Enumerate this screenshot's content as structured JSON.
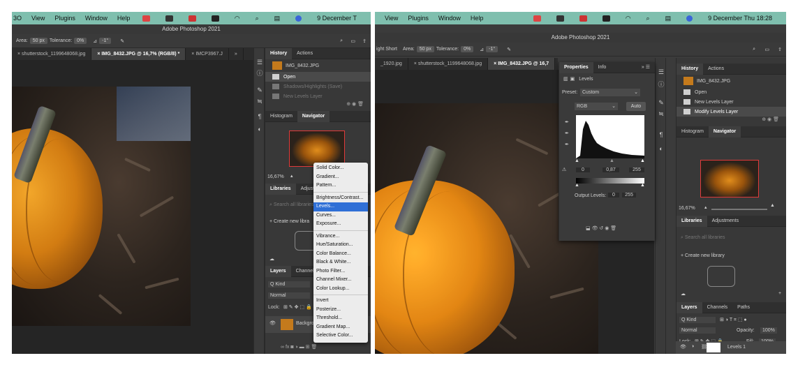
{
  "left": {
    "menubar": {
      "items": [
        "3O",
        "View",
        "Plugins",
        "Window",
        "Help"
      ],
      "date": "9 December T"
    },
    "app_title": "Adobe Photoshop 2021",
    "options": {
      "area_label": "Area:",
      "area_value": "50 px",
      "tolerance_label": "Tolerance:",
      "tolerance_value": "0%",
      "angle": "-1°"
    },
    "tabs": [
      "shutterstock_1199648068.jpg",
      "IMG_8432.JPG @ 16,7% (RGB/8) *",
      "IMCP3967.J"
    ],
    "history": {
      "tabs": [
        "History",
        "Actions"
      ],
      "snapshot": "IMG_8432.JPG",
      "items": [
        "Open",
        "Shadows/Highlights (Save)",
        "New Levels Layer"
      ]
    },
    "navigator": {
      "tabs": [
        "Histogram",
        "Navigator"
      ],
      "zoom": "16,67%"
    },
    "libraries": {
      "tabs": [
        "Libraries",
        "Adjustme"
      ],
      "search_placeholder": "Search all libraries",
      "create": "Create new libra"
    },
    "layers": {
      "tabs": [
        "Layers",
        "Channels"
      ],
      "kind": "Q Kind",
      "mode": "Normal",
      "lock_label": "Lock:",
      "layer_name": "Backgrou"
    },
    "menu": {
      "groups": [
        [
          "Solid Color...",
          "Gradient...",
          "Pattern..."
        ],
        [
          "Brightness/Contrast...",
          "Levels...",
          "Curves...",
          "Exposure..."
        ],
        [
          "Vibrance...",
          "Hue/Saturation...",
          "Color Balance...",
          "Black & White...",
          "Photo Filter...",
          "Channel Mixer...",
          "Color Lookup..."
        ],
        [
          "Invert",
          "Posterize...",
          "Threshold...",
          "Gradient Map...",
          "Selective Color..."
        ]
      ],
      "highlighted": "Levels..."
    }
  },
  "right": {
    "menubar": {
      "items": [
        "View",
        "Plugins",
        "Window",
        "Help"
      ],
      "date": "9 December Thu 18:28"
    },
    "app_title": "Adobe Photoshop 2021",
    "options": {
      "sample_value": "ight Short",
      "area_label": "Area:",
      "area_value": "50 px",
      "tolerance_label": "Tolerance:",
      "tolerance_value": "0%",
      "angle": "-1°"
    },
    "tabs": [
      "_1920.jpg",
      "shutterstock_1199648068.jpg",
      "IMG_8432.JPG @ 16,7"
    ],
    "properties": {
      "tabs": [
        "Properties",
        "Info"
      ],
      "title": "Levels",
      "preset_label": "Preset:",
      "preset_value": "Custom",
      "channel": "RGB",
      "auto": "Auto",
      "input_levels": [
        "0",
        "0,87",
        "255"
      ],
      "output_label": "Output Levels:",
      "output_levels": [
        "0",
        "255"
      ]
    },
    "history": {
      "tabs": [
        "History",
        "Actions"
      ],
      "snapshot": "IMG_8432.JPG",
      "items": [
        "Open",
        "New Levels Layer",
        "Modify Levels Layer"
      ]
    },
    "navigator": {
      "tabs": [
        "Histogram",
        "Navigator"
      ],
      "zoom": "16,67%"
    },
    "libraries": {
      "tabs": [
        "Libraries",
        "Adjustments"
      ],
      "search_placeholder": "Search all libraries",
      "create": "Create new library"
    },
    "layers": {
      "tabs": [
        "Layers",
        "Channels",
        "Paths"
      ],
      "kind": "Q Kind",
      "mode": "Normal",
      "opacity_label": "Opacity:",
      "opacity_value": "100%",
      "lock_label": "Lock:",
      "fill_label": "Fill:",
      "fill_value": "100%",
      "layer_name": "Levels 1"
    }
  },
  "colors": {
    "menubar": "#7fbfae",
    "panel": "#383838",
    "highlight": "#2f6fd6",
    "navigator_frame": "#e03a3a"
  }
}
